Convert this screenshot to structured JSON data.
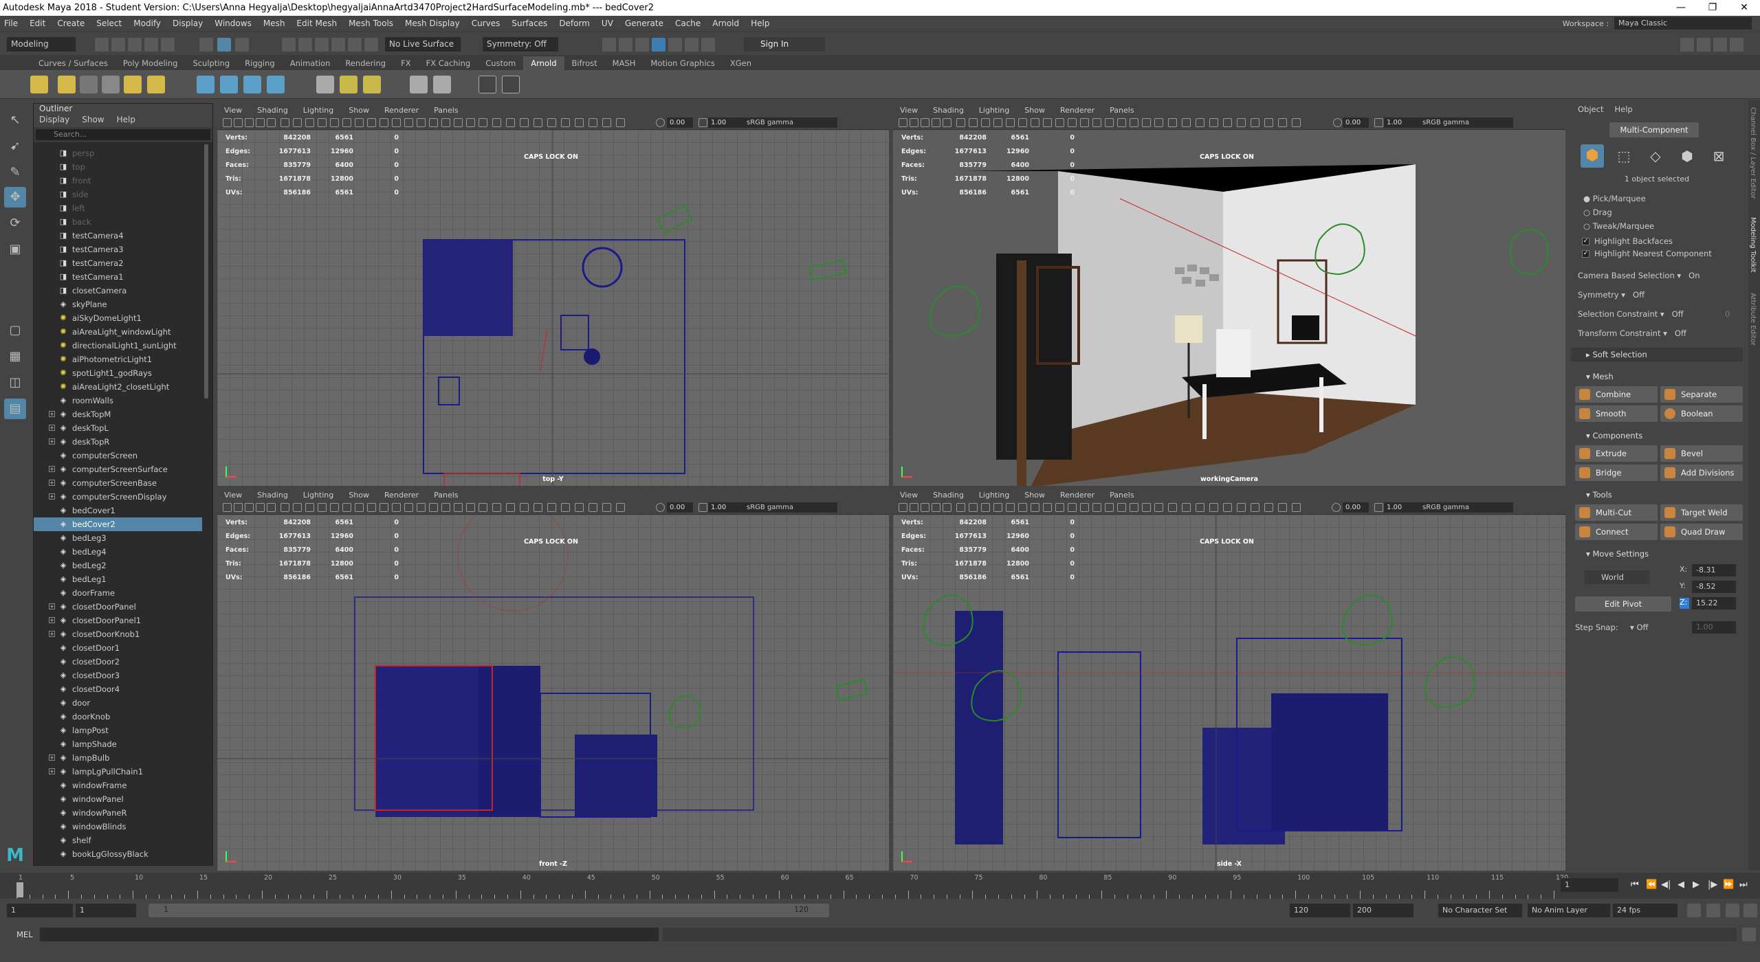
{
  "window": {
    "title": "Autodesk Maya 2018 - Student Version: C:\\Users\\Anna Hegyalja\\Desktop\\hegyaljaiAnnaArtd3470Project2HardSurfaceModeling.mb* --- bedCover2",
    "minimize": "—",
    "maximize": "❐",
    "close": "✕"
  },
  "menubar": [
    "File",
    "Edit",
    "Create",
    "Select",
    "Modify",
    "Display",
    "Windows",
    "Mesh",
    "Edit Mesh",
    "Mesh Tools",
    "Mesh Display",
    "Curves",
    "Surfaces",
    "Deform",
    "UV",
    "Generate",
    "Cache",
    "Arnold",
    "Help"
  ],
  "workspace": {
    "label": "Workspace :",
    "value": "Maya Classic"
  },
  "statusline": {
    "mode": "Modeling",
    "live_surface": "No Live Surface",
    "symmetry": "Symmetry: Off",
    "sign_in": "Sign In"
  },
  "shelf_tabs": [
    "Curves / Surfaces",
    "Poly Modeling",
    "Sculpting",
    "Rigging",
    "Animation",
    "Rendering",
    "FX",
    "FX Caching",
    "Custom",
    "Arnold",
    "Bifrost",
    "MASH",
    "Motion Graphics",
    "XGen"
  ],
  "shelf_active": "Arnold",
  "outliner": {
    "title": "Outliner",
    "menu": [
      "Display",
      "Show",
      "Help"
    ],
    "search_placeholder": "Search...",
    "items": [
      {
        "label": "persp",
        "dim": true,
        "exp": false,
        "icon": "cam"
      },
      {
        "label": "top",
        "dim": true,
        "exp": false,
        "icon": "cam"
      },
      {
        "label": "front",
        "dim": true,
        "exp": false,
        "icon": "cam"
      },
      {
        "label": "side",
        "dim": true,
        "exp": false,
        "icon": "cam"
      },
      {
        "label": "left",
        "dim": true,
        "exp": false,
        "icon": "cam"
      },
      {
        "label": "back",
        "dim": true,
        "exp": false,
        "icon": "cam"
      },
      {
        "label": "testCamera4",
        "dim": false,
        "exp": false,
        "icon": "cam"
      },
      {
        "label": "testCamera3",
        "dim": false,
        "exp": false,
        "icon": "cam"
      },
      {
        "label": "testCamera2",
        "dim": false,
        "exp": false,
        "icon": "cam"
      },
      {
        "label": "testCamera1",
        "dim": false,
        "exp": false,
        "icon": "cam"
      },
      {
        "label": "closetCamera",
        "dim": false,
        "exp": false,
        "icon": "cam"
      },
      {
        "label": "skyPlane",
        "dim": false,
        "exp": false,
        "icon": "mesh"
      },
      {
        "label": "aiSkyDomeLight1",
        "dim": false,
        "exp": false,
        "icon": "light"
      },
      {
        "label": "aiAreaLight_windowLight",
        "dim": false,
        "exp": false,
        "icon": "light"
      },
      {
        "label": "directionalLight1_sunLight",
        "dim": false,
        "exp": false,
        "icon": "light"
      },
      {
        "label": "aiPhotometricLight1",
        "dim": false,
        "exp": false,
        "icon": "light"
      },
      {
        "label": "spotLight1_godRays",
        "dim": false,
        "exp": false,
        "icon": "light"
      },
      {
        "label": "aiAreaLight2_closetLight",
        "dim": false,
        "exp": false,
        "icon": "light"
      },
      {
        "label": "roomWalls",
        "dim": false,
        "exp": false,
        "icon": "mesh"
      },
      {
        "label": "deskTopM",
        "dim": false,
        "exp": true,
        "icon": "mesh"
      },
      {
        "label": "deskTopL",
        "dim": false,
        "exp": true,
        "icon": "mesh"
      },
      {
        "label": "deskTopR",
        "dim": false,
        "exp": true,
        "icon": "mesh"
      },
      {
        "label": "computerScreen",
        "dim": false,
        "exp": false,
        "icon": "mesh"
      },
      {
        "label": "computerScreenSurface",
        "dim": false,
        "exp": true,
        "icon": "mesh"
      },
      {
        "label": "computerScreenBase",
        "dim": false,
        "exp": true,
        "icon": "mesh"
      },
      {
        "label": "computerScreenDisplay",
        "dim": false,
        "exp": true,
        "icon": "mesh"
      },
      {
        "label": "bedCover1",
        "dim": false,
        "exp": false,
        "icon": "mesh"
      },
      {
        "label": "bedCover2",
        "dim": false,
        "exp": false,
        "icon": "mesh",
        "selected": true
      },
      {
        "label": "bedLeg3",
        "dim": false,
        "exp": false,
        "icon": "mesh"
      },
      {
        "label": "bedLeg4",
        "dim": false,
        "exp": false,
        "icon": "mesh"
      },
      {
        "label": "bedLeg2",
        "dim": false,
        "exp": false,
        "icon": "mesh"
      },
      {
        "label": "bedLeg1",
        "dim": false,
        "exp": false,
        "icon": "mesh"
      },
      {
        "label": "doorFrame",
        "dim": false,
        "exp": false,
        "icon": "mesh"
      },
      {
        "label": "closetDoorPanel",
        "dim": false,
        "exp": true,
        "icon": "mesh"
      },
      {
        "label": "closetDoorPanel1",
        "dim": false,
        "exp": true,
        "icon": "mesh"
      },
      {
        "label": "closetDoorKnob1",
        "dim": false,
        "exp": true,
        "icon": "mesh"
      },
      {
        "label": "closetDoor1",
        "dim": false,
        "exp": false,
        "icon": "mesh"
      },
      {
        "label": "closetDoor2",
        "dim": false,
        "exp": false,
        "icon": "mesh"
      },
      {
        "label": "closetDoor3",
        "dim": false,
        "exp": false,
        "icon": "mesh"
      },
      {
        "label": "closetDoor4",
        "dim": false,
        "exp": false,
        "icon": "mesh"
      },
      {
        "label": "door",
        "dim": false,
        "exp": false,
        "icon": "mesh"
      },
      {
        "label": "doorKnob",
        "dim": false,
        "exp": false,
        "icon": "mesh"
      },
      {
        "label": "lampPost",
        "dim": false,
        "exp": false,
        "icon": "mesh"
      },
      {
        "label": "lampShade",
        "dim": false,
        "exp": false,
        "icon": "mesh"
      },
      {
        "label": "lampBulb",
        "dim": false,
        "exp": true,
        "icon": "mesh"
      },
      {
        "label": "lampLgPullChain1",
        "dim": false,
        "exp": true,
        "icon": "mesh"
      },
      {
        "label": "windowFrame",
        "dim": false,
        "exp": false,
        "icon": "mesh"
      },
      {
        "label": "windowPanel",
        "dim": false,
        "exp": false,
        "icon": "mesh"
      },
      {
        "label": "windowPaneR",
        "dim": false,
        "exp": false,
        "icon": "mesh"
      },
      {
        "label": "windowBlinds",
        "dim": false,
        "exp": false,
        "icon": "mesh"
      },
      {
        "label": "shelf",
        "dim": false,
        "exp": false,
        "icon": "mesh"
      },
      {
        "label": "bookLgGlossyBlack",
        "dim": false,
        "exp": false,
        "icon": "mesh"
      }
    ]
  },
  "viewport_common": {
    "menu": [
      "View",
      "Shading",
      "Lighting",
      "Show",
      "Renderer",
      "Panels"
    ],
    "exposure": "0.00",
    "gamma": "1.00",
    "colorspace": "sRGB gamma",
    "caps": "CAPS LOCK ON"
  },
  "hud_labels": [
    "Verts:",
    "Edges:",
    "Faces:",
    "Tris:",
    "UVs:"
  ],
  "hud_values": [
    [
      "842208",
      "6561",
      "0"
    ],
    [
      "1677613",
      "12960",
      "0"
    ],
    [
      "835779",
      "6400",
      "0"
    ],
    [
      "1671878",
      "12800",
      "0"
    ],
    [
      "856186",
      "6561",
      "0"
    ]
  ],
  "viewports": [
    {
      "camera": "top -Y"
    },
    {
      "camera": "workingCamera"
    },
    {
      "camera": "front -Z"
    },
    {
      "camera": "side -X"
    }
  ],
  "modeling_toolkit": {
    "menu": [
      "Object",
      "Help"
    ],
    "mode_button": "Multi-Component",
    "selected_text": "1 object selected",
    "radio": [
      "Pick/Marquee",
      "Drag",
      "Tweak/Marquee"
    ],
    "checks": [
      "Highlight Backfaces",
      "Highlight Nearest Component"
    ],
    "camera_based": {
      "label": "Camera Based Selection",
      "value": "On"
    },
    "symmetry": {
      "label": "Symmetry",
      "value": "Off"
    },
    "selection_constraint": {
      "label": "Selection Constraint",
      "value": "Off",
      "num": "0"
    },
    "transform_constraint": {
      "label": "Transform Constraint",
      "value": "Off"
    },
    "soft_selection": "Soft Selection",
    "sections": {
      "mesh": "Mesh",
      "components": "Components",
      "tools": "Tools",
      "move": "Move Settings"
    },
    "mesh_buttons": [
      "Combine",
      "Separate",
      "Smooth",
      "Boolean"
    ],
    "component_buttons": [
      "Extrude",
      "Bevel",
      "Bridge",
      "Add Divisions"
    ],
    "tool_buttons": [
      "Multi-Cut",
      "Target Weld",
      "Connect",
      "Quad Draw"
    ],
    "move": {
      "space": "World",
      "x": "-8.31",
      "y": "-8.52",
      "z": "15.22",
      "edit_pivot": "Edit Pivot",
      "step_snap": "Step Snap:",
      "step_value": "Off",
      "step_num": "1.00"
    },
    "axis_labels": {
      "x": "X:",
      "y": "Y:",
      "z": "Z:"
    }
  },
  "right_tabs": [
    "Channel Box / Layer Editor",
    "Modeling Toolkit",
    "Attribute Editor"
  ],
  "timeline": {
    "ticks": [
      "1",
      "5",
      "10",
      "15",
      "20",
      "25",
      "30",
      "35",
      "40",
      "45",
      "50",
      "55",
      "60",
      "65",
      "70",
      "75",
      "80",
      "85",
      "90",
      "95",
      "100",
      "105",
      "110",
      "115",
      "120"
    ],
    "current_frame": "1"
  },
  "range": {
    "start": "1",
    "anim_start": "1",
    "slider_start": "1",
    "slider_end": "120",
    "anim_end": "120",
    "end": "200",
    "char_set": "No Character Set",
    "anim_layer": "No Anim Layer",
    "fps": "24 fps"
  },
  "cmdline": {
    "label": "MEL"
  }
}
